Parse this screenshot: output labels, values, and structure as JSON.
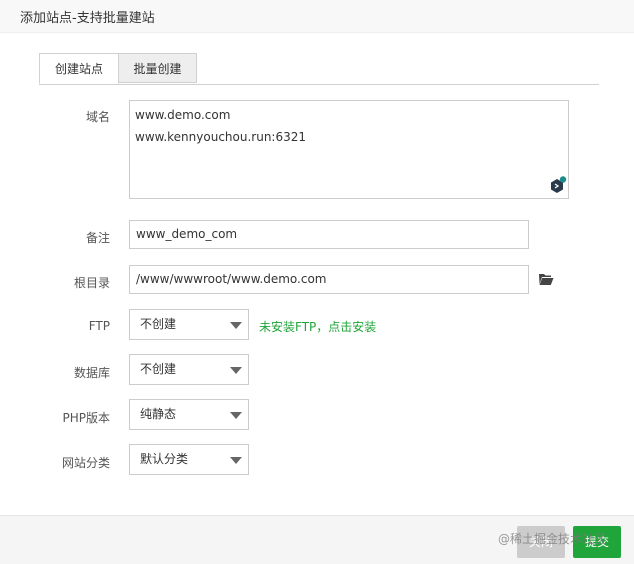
{
  "dialog": {
    "title": "添加站点-支持批量建站"
  },
  "tabs": [
    {
      "label": "创建站点",
      "active": true
    },
    {
      "label": "批量创建",
      "active": false
    }
  ],
  "form": {
    "domain": {
      "label": "域名",
      "lines": [
        "www.demo.com",
        "www.kennyouchou.run:6321"
      ]
    },
    "remark": {
      "label": "备注",
      "value": "www_demo_com"
    },
    "root": {
      "label": "根目录",
      "value": "/www/wwwroot/www.demo.com",
      "icon": "folder-open-icon"
    },
    "ftp": {
      "label": "FTP",
      "selected": "不创建",
      "hint": "未安装FTP，点击安装"
    },
    "database": {
      "label": "数据库",
      "selected": "不创建"
    },
    "php": {
      "label": "PHP版本",
      "selected": "纯静态"
    },
    "category": {
      "label": "网站分类",
      "selected": "默认分类"
    }
  },
  "footer": {
    "close_label": "关闭",
    "submit_label": "提交"
  },
  "watermark": "@稀土掘金技术社区",
  "colors": {
    "accent": "#20a53a",
    "close_button": "#cccccc"
  }
}
